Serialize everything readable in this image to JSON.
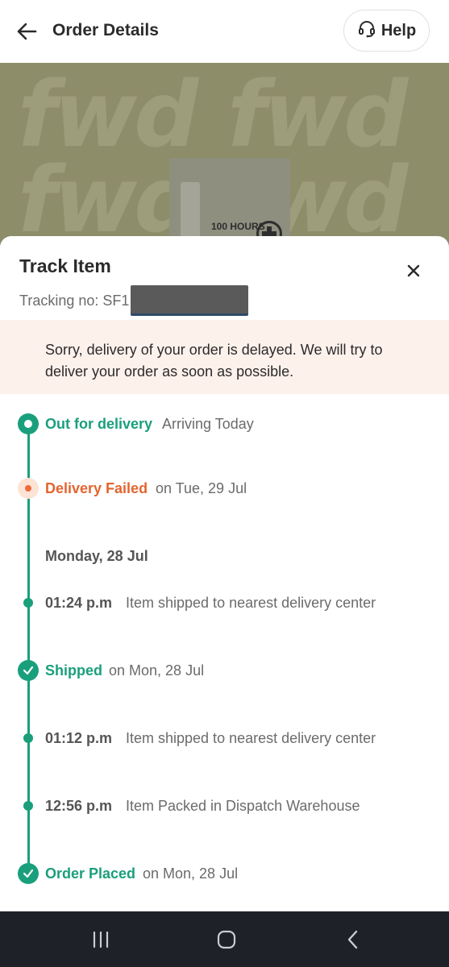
{
  "header": {
    "title": "Order Details",
    "help_label": "Help"
  },
  "banner": {
    "brand_text": "fwd",
    "product_text": "100 HOURS"
  },
  "sheet": {
    "title": "Track Item",
    "tracking_prefix": "Tracking no: SF1",
    "notice": "Sorry, delivery of your order is delayed. We will try to deliver your order as soon as possible."
  },
  "timeline": {
    "out_for_delivery": {
      "status": "Out for delivery",
      "detail": "Arriving Today"
    },
    "delivery_failed": {
      "status": "Delivery Failed",
      "detail": "on Tue, 29 Jul"
    },
    "date_header": "Monday, 28 Jul",
    "event1": {
      "time": "01:24 p.m",
      "text": "Item shipped to nearest delivery center"
    },
    "shipped": {
      "status": "Shipped",
      "detail": "on Mon, 28 Jul"
    },
    "event2": {
      "time": "01:12 p.m",
      "text": "Item shipped to nearest delivery center"
    },
    "event3": {
      "time": "12:56 p.m",
      "text": "Item Packed in Dispatch Warehouse"
    },
    "order_placed": {
      "status": "Order Placed",
      "detail": "on Mon, 28 Jul"
    }
  },
  "colors": {
    "accent_green": "#1a9f7c",
    "failed_orange": "#e3652f",
    "notice_bg": "#fdf1ec"
  },
  "icons": [
    "arrow-left-icon",
    "headset-icon",
    "close-icon",
    "check-icon",
    "recents-icon",
    "home-icon",
    "back-chevron-icon"
  ]
}
